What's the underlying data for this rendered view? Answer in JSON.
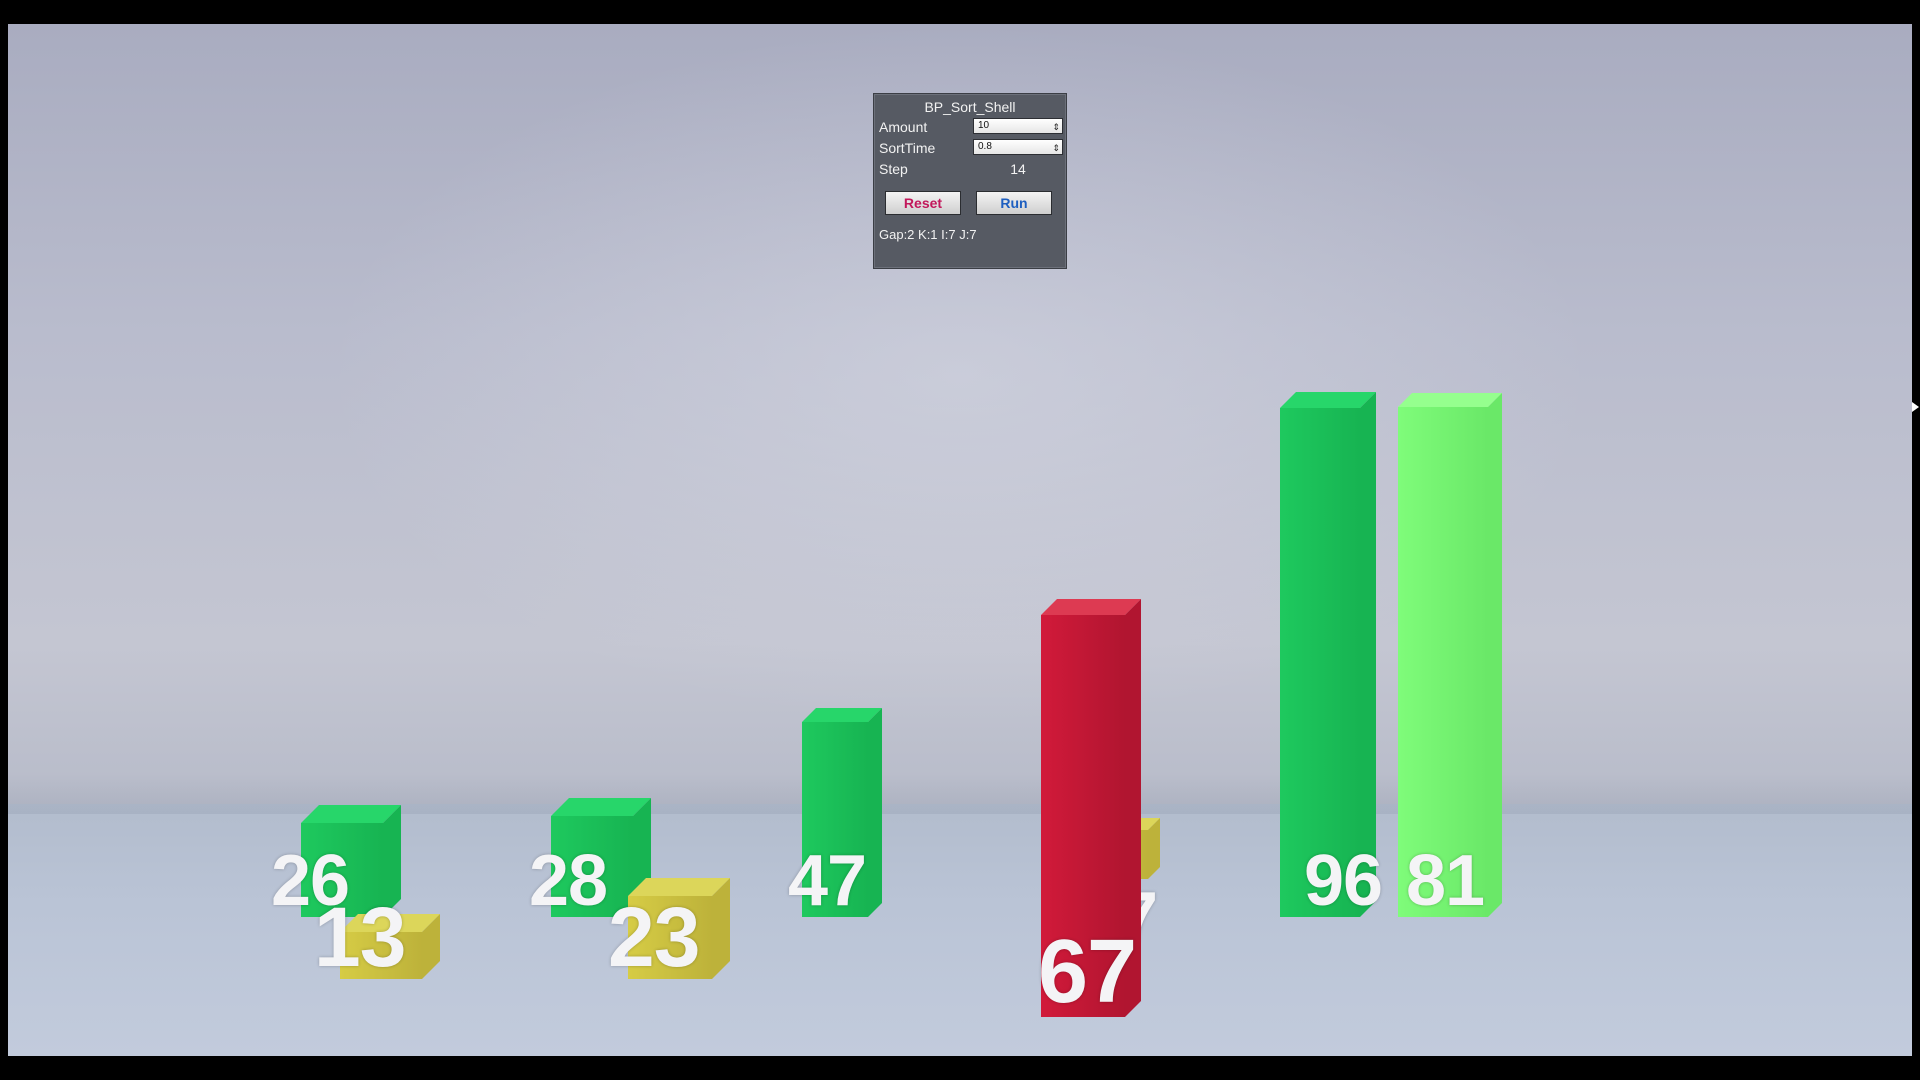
{
  "panel": {
    "title": "BP_Sort_Shell",
    "amount_label": "Amount",
    "amount_value": "10",
    "sorttime_label": "SortTime",
    "sorttime_value": "0.8",
    "step_label": "Step",
    "step_value": "14",
    "reset_label": "Reset",
    "run_label": "Run",
    "status": "Gap:2 K:1 I:7 J:7"
  },
  "colors": {
    "green": "#1ec95e",
    "light_green": "#7ffc7a",
    "yellow": "#d6cc45",
    "red": "#d11a3a",
    "reset_text": "#c2185b",
    "run_text": "#1e5fc0"
  },
  "bars": [
    {
      "value": 26,
      "label": "26",
      "color": "green"
    },
    {
      "value": 13,
      "label": "13",
      "color": "yellow"
    },
    {
      "value": 28,
      "label": "28",
      "color": "green"
    },
    {
      "value": 23,
      "label": "23",
      "color": "yellow"
    },
    {
      "value": 47,
      "label": "47",
      "color": "green"
    },
    {
      "value": 67,
      "label": "67",
      "color": "red"
    },
    {
      "value": 7,
      "label": "7",
      "color": "yellow"
    },
    {
      "value": 96,
      "label": "96",
      "color": "green"
    },
    {
      "value": 81,
      "label": "81",
      "color": "light_green"
    }
  ]
}
